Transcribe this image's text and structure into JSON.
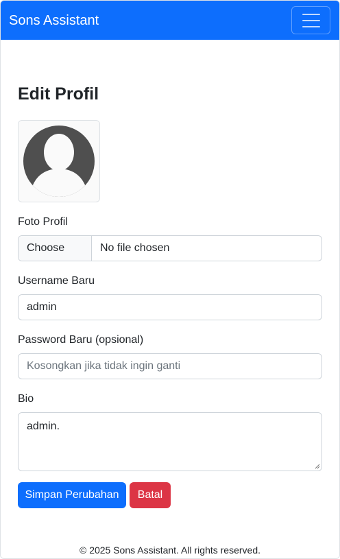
{
  "navbar": {
    "brand": "Sons Assistant",
    "toggle_icon": "hamburger-menu-icon"
  },
  "page": {
    "title": "Edit Profil"
  },
  "avatar": {
    "icon": "default-user-avatar-icon"
  },
  "form": {
    "photo_label": "Foto Profil",
    "file_button": "Choose File",
    "file_status": "No file chosen",
    "username_label": "Username Baru",
    "username_value": "admin",
    "password_label": "Password Baru (opsional)",
    "password_placeholder": "Kosongkan jika tidak ingin ganti",
    "bio_label": "Bio",
    "bio_value": "admin."
  },
  "actions": {
    "save_label": "Simpan Perubahan",
    "cancel_label": "Batal"
  },
  "footer": {
    "text": "© 2025 Sons Assistant. All rights reserved."
  },
  "colors": {
    "primary": "#0d6efd",
    "danger": "#dc3545",
    "avatar": "#4f4f4f"
  }
}
